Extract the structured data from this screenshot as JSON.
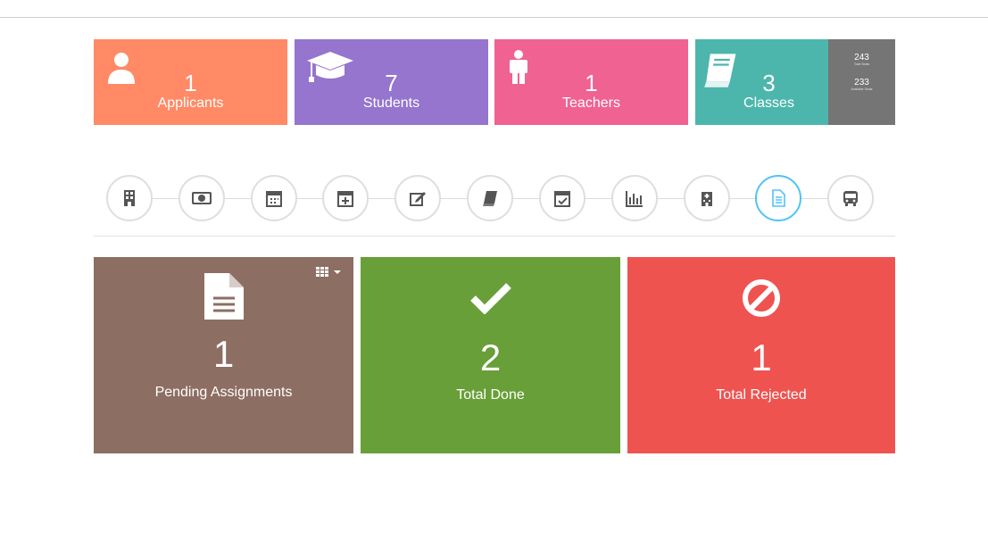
{
  "stats": [
    {
      "key": "applicants",
      "value": "1",
      "label": "Applicants",
      "icon": "user-icon",
      "color": "#ff8a65"
    },
    {
      "key": "students",
      "value": "7",
      "label": "Students",
      "icon": "graduation-cap-icon",
      "color": "#9575cd"
    },
    {
      "key": "teachers",
      "value": "1",
      "label": "Teachers",
      "icon": "person-icon",
      "color": "#f06292"
    },
    {
      "key": "classes",
      "value": "3",
      "label": "Classes",
      "icon": "book-icon",
      "color": "#4db6ac"
    }
  ],
  "seats": {
    "total_value": "243",
    "total_label": "Total Seats",
    "available_value": "233",
    "available_label": "Available Seats"
  },
  "nav_icons": [
    "building-icon",
    "money-icon",
    "calendar-icon",
    "calendar-plus-icon",
    "edit-icon",
    "book-icon",
    "calendar-check-icon",
    "bar-chart-icon",
    "hospital-icon",
    "document-icon",
    "bus-icon"
  ],
  "active_nav": "document-icon",
  "cards": [
    {
      "value": "1",
      "label": "Pending Assignments",
      "icon": "document-icon",
      "color": "#8d6e63"
    },
    {
      "value": "2",
      "label": "Total Done",
      "icon": "check-icon",
      "color": "#689f38"
    },
    {
      "value": "1",
      "label": "Total Rejected",
      "icon": "ban-icon",
      "color": "#ef5350"
    }
  ]
}
